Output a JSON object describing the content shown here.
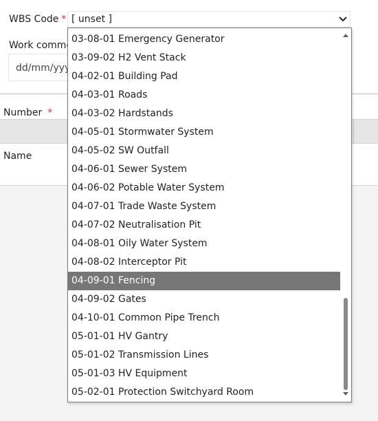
{
  "form": {
    "wbs_code_label": "WBS Code",
    "required_mark": "*",
    "wbs_select_value": "[ unset ]",
    "work_commenced_label": "Work commen",
    "date_placeholder": "dd/mm/yyy"
  },
  "table": {
    "number_label": "Number",
    "number_required_mark": "*",
    "name_label": "Name"
  },
  "dropdown": {
    "selected_value": "04-09-01 Fencing",
    "options": [
      "03-08-01 Emergency Generator",
      "03-09-02 H2 Vent Stack",
      "04-02-01 Building Pad",
      "04-03-01 Roads",
      "04-03-02 Hardstands",
      "04-05-01 Stormwater System",
      "04-05-02 SW Outfall",
      "04-06-01 Sewer System",
      "04-06-02 Potable Water System",
      "04-07-01 Trade Waste System",
      "04-07-02 Neutralisation Pit",
      "04-08-01 Oily Water System",
      "04-08-02 Interceptor Pit",
      "04-09-01 Fencing",
      "04-09-02 Gates",
      "04-10-01 Common Pipe Trench",
      "05-01-01 HV Gantry",
      "05-01-02 Transmission Lines",
      "05-01-03 HV Equipment",
      "05-02-01 Protection Switchyard Room"
    ],
    "scroll_position_fraction": 0.72
  },
  "colors": {
    "selected_option_bg": "#777777",
    "required_mark": "#d32f2f",
    "lower_bg": "#f3f3f3"
  },
  "icons": {
    "select_caret": "chevron-down-icon",
    "scroll_up": "triangle-up-icon",
    "scroll_down": "triangle-down-icon"
  }
}
